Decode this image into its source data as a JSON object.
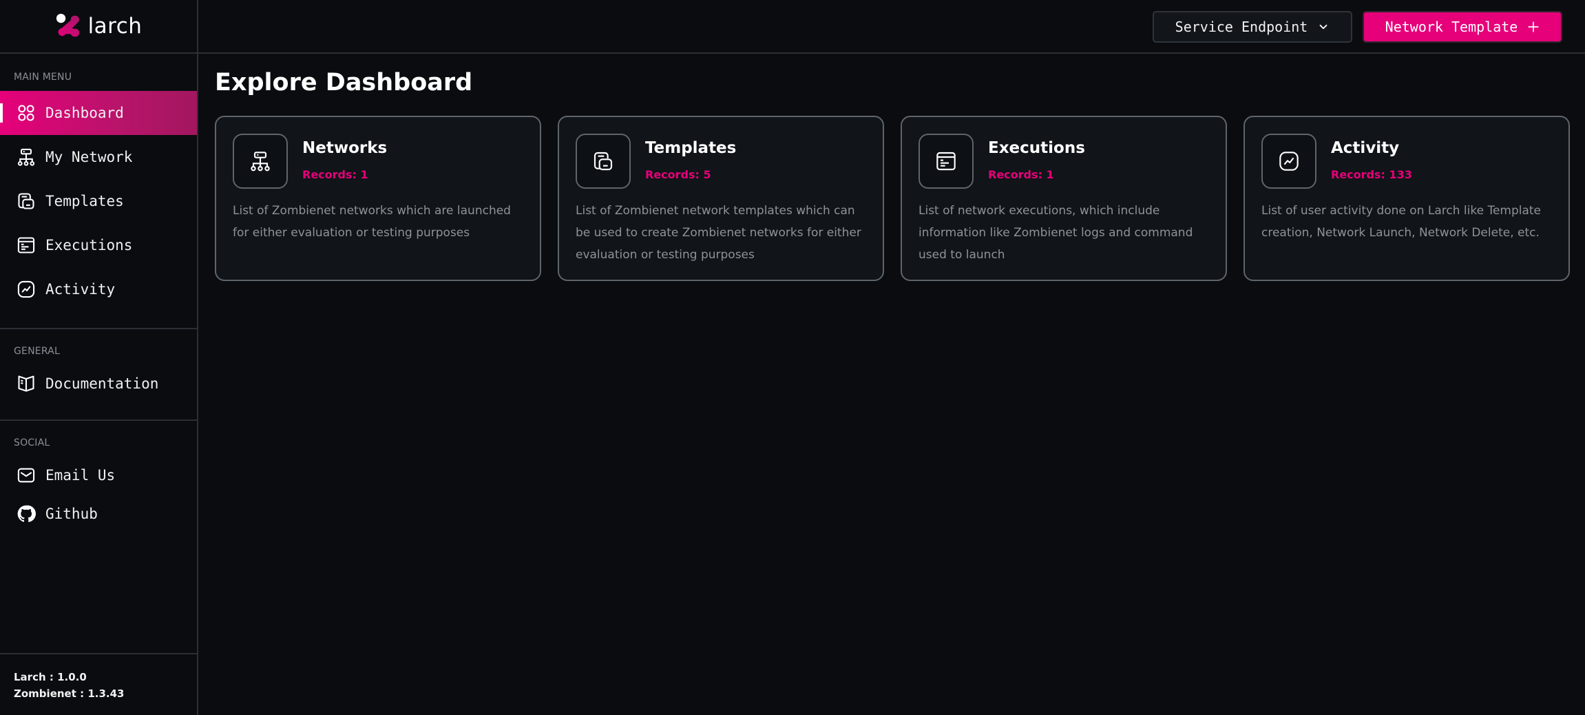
{
  "app": {
    "name": "larch",
    "accent_color": "#e6007a"
  },
  "sidebar": {
    "sections": [
      {
        "label": "MAIN MENU",
        "items": [
          {
            "label": "Dashboard",
            "icon": "dashboard-grid-icon",
            "active": true
          },
          {
            "label": "My Network",
            "icon": "network-icon",
            "active": false
          },
          {
            "label": "Templates",
            "icon": "templates-icon",
            "active": false
          },
          {
            "label": "Executions",
            "icon": "executions-icon",
            "active": false
          },
          {
            "label": "Activity",
            "icon": "activity-icon",
            "active": false
          }
        ]
      },
      {
        "label": "GENERAL",
        "items": [
          {
            "label": "Documentation",
            "icon": "book-icon"
          }
        ]
      },
      {
        "label": "SOCIAL",
        "items": [
          {
            "label": "Email Us",
            "icon": "mail-icon"
          },
          {
            "label": "Github",
            "icon": "github-icon"
          }
        ]
      }
    ],
    "versions": [
      {
        "label": "Larch :",
        "value": "1.0.0"
      },
      {
        "label": "Zombienet :",
        "value": "1.3.43"
      }
    ]
  },
  "topbar": {
    "endpoint_label": "Service Endpoint",
    "endpoint_icon": "chevron-down-icon",
    "template_label": "Network Template",
    "template_icon": "plus-icon"
  },
  "main": {
    "title": "Explore Dashboard",
    "cards": [
      {
        "title": "Networks",
        "records": "Records: 1",
        "icon": "network-icon",
        "description": "List of Zombienet networks which are launched for either evaluation or testing purposes"
      },
      {
        "title": "Templates",
        "records": "Records: 5",
        "icon": "templates-icon",
        "description": "List of Zombienet network templates which can be used to create Zombienet networks for either evaluation or testing purposes"
      },
      {
        "title": "Executions",
        "records": "Records: 1",
        "icon": "executions-icon",
        "description": "List of network executions, which include information like Zombienet logs and command used to launch"
      },
      {
        "title": "Activity",
        "records": "Records: 133",
        "icon": "activity-icon",
        "description": "List of user activity done on Larch like Template creation, Network Launch, Network Delete, etc."
      }
    ]
  }
}
